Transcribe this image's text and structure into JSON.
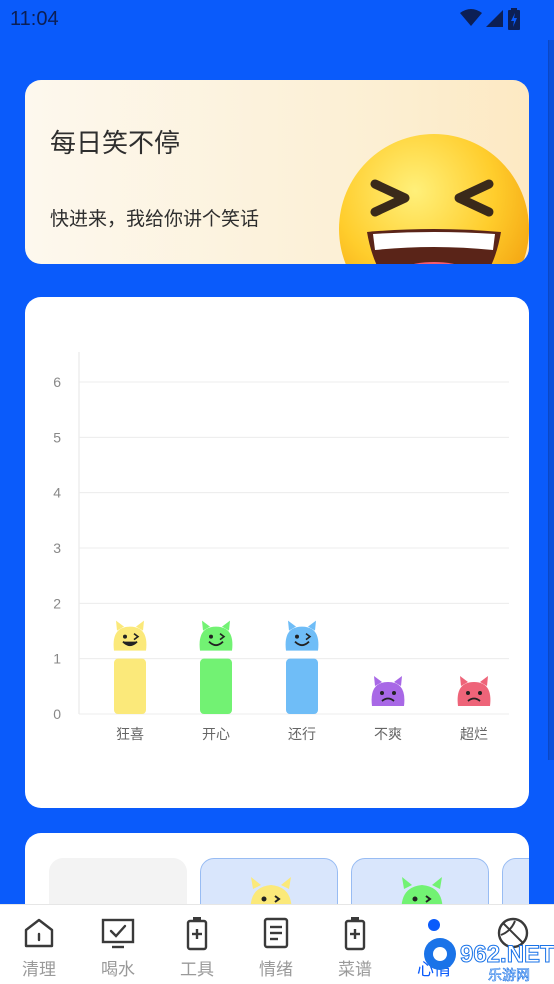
{
  "status": {
    "time": "11:04"
  },
  "banner": {
    "title": "每日笑不停",
    "subtitle": "快进来，我给你讲个笑话"
  },
  "chart_data": {
    "type": "bar",
    "categories": [
      "狂喜",
      "开心",
      "还行",
      "不爽",
      "超烂"
    ],
    "values": [
      1,
      1,
      1,
      0,
      0
    ],
    "ylim": [
      0,
      6.5
    ],
    "yticks": [
      "0",
      "1",
      "2",
      "3",
      "4",
      "5",
      "6"
    ],
    "colors": [
      "#fbe97a",
      "#72f273",
      "#6fbdf7",
      "#a868e6",
      "#ee6479"
    ],
    "grid": true,
    "title": "",
    "xlabel": "",
    "ylabel": ""
  },
  "mood_tiles": [
    {
      "color": "#f2f2f2",
      "border": "#f2f2f2"
    },
    {
      "color": "#d8e6fc",
      "border": "#9fc0f3"
    },
    {
      "color": "#d8e6fc",
      "border": "#9fc0f3"
    },
    {
      "color": "#d8e6fc",
      "border": "#9fc0f3"
    }
  ],
  "nav": {
    "items": [
      {
        "label": "清理",
        "icon": "house-icon"
      },
      {
        "label": "喝水",
        "icon": "monitor-check-icon"
      },
      {
        "label": "工具",
        "icon": "battery-plus-icon"
      },
      {
        "label": "情绪",
        "icon": "document-icon"
      },
      {
        "label": "菜谱",
        "icon": "battery-plus-icon"
      },
      {
        "label": "心情",
        "icon": "mood-icon"
      },
      {
        "label": "",
        "icon": "ball-icon"
      }
    ]
  },
  "watermark": {
    "text": "962.NET",
    "sub": "乐游网"
  }
}
